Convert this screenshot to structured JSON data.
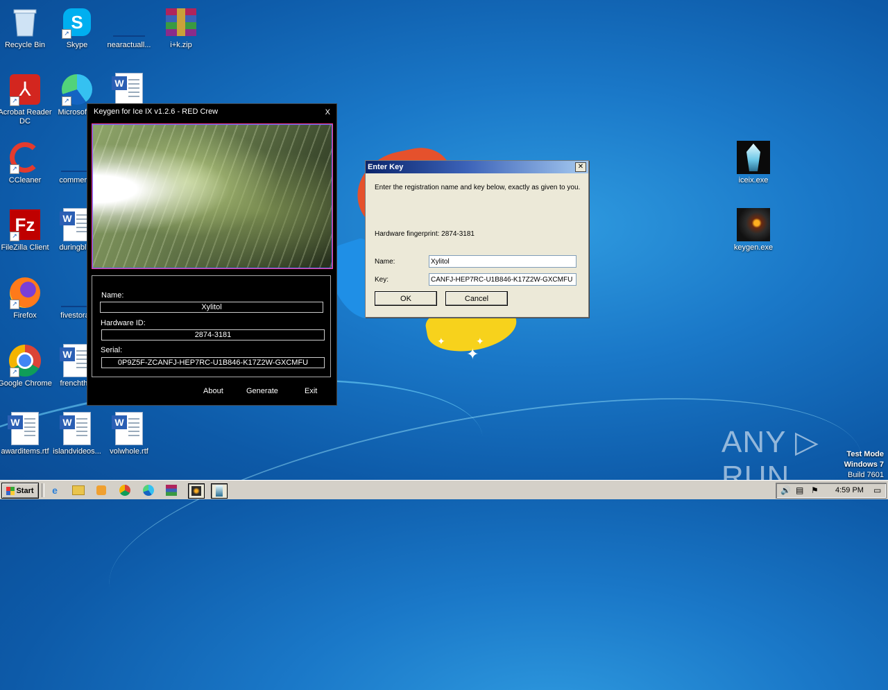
{
  "desktop": {
    "icons": [
      {
        "label": "Recycle Bin"
      },
      {
        "label": "Skype"
      },
      {
        "label": "nearactuall..."
      },
      {
        "label": "i+k.zip"
      },
      {
        "label": "Acrobat Reader DC"
      },
      {
        "label": "Microsoft E"
      },
      {
        "label": "CCleaner"
      },
      {
        "label": "commerce"
      },
      {
        "label": "FileZilla Client"
      },
      {
        "label": "duringblue"
      },
      {
        "label": "Firefox"
      },
      {
        "label": "fivestorag"
      },
      {
        "label": "Google Chrome"
      },
      {
        "label": "frenchthat"
      },
      {
        "label": "awarditems.rtf"
      },
      {
        "label": "islandvideos..."
      },
      {
        "label": "volwhole.rtf"
      },
      {
        "label": "iceix.exe"
      },
      {
        "label": "keygen.exe"
      }
    ]
  },
  "keygen": {
    "title": "Keygen for Ice IX v1.2.6 - RED Crew",
    "close": "X",
    "name_label": "Name:",
    "name_value": "Xylitol",
    "hwid_label": "Hardware ID:",
    "hwid_value": "2874-3181",
    "serial_label": "Serial:",
    "serial_value": "0P9Z5F-ZCANFJ-HEP7RC-U1B846-K17Z2W-GXCMFU",
    "about": "About",
    "generate": "Generate",
    "exit": "Exit"
  },
  "dialog": {
    "title": "Enter Key",
    "close": "✕",
    "instructions": "Enter the registration name and key below, exactly as given to you.",
    "fingerprint": "Hardware fingerprint: 2874-3181",
    "name_label": "Name:",
    "name_value": "Xylitol",
    "key_label": "Key:",
    "key_value": "CANFJ-HEP7RC-U1B846-K17Z2W-GXCMFU",
    "ok": "OK",
    "cancel": "Cancel"
  },
  "watermark": "ANY ▷ RUN",
  "system": {
    "test_mode": "Test Mode",
    "os": "Windows 7",
    "build": "Build 7601"
  },
  "taskbar": {
    "start": "Start",
    "clock": "4:59 PM"
  }
}
